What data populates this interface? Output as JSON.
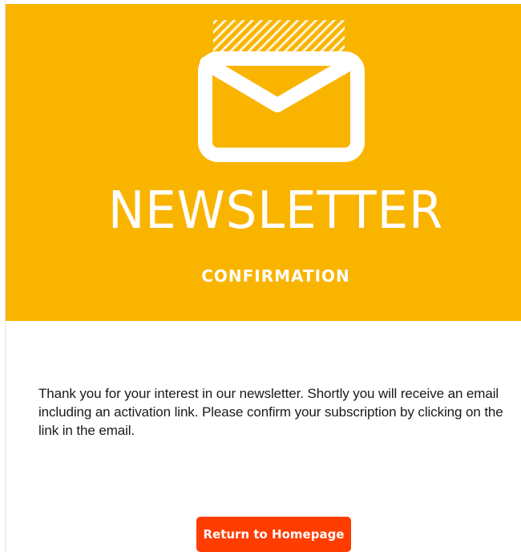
{
  "hero": {
    "icon": "envelope-icon",
    "title": "NEWSLETTER",
    "subtitle": "CONFIRMATION",
    "background_color": "#f9b400"
  },
  "message": {
    "text": "Thank you for your interest in our newsletter. Shortly you will receive an email including an activation link. Please confirm your subscription by clicking on the link in the email."
  },
  "cta": {
    "label": "Return to Homepage",
    "color": "#ff3d00"
  }
}
